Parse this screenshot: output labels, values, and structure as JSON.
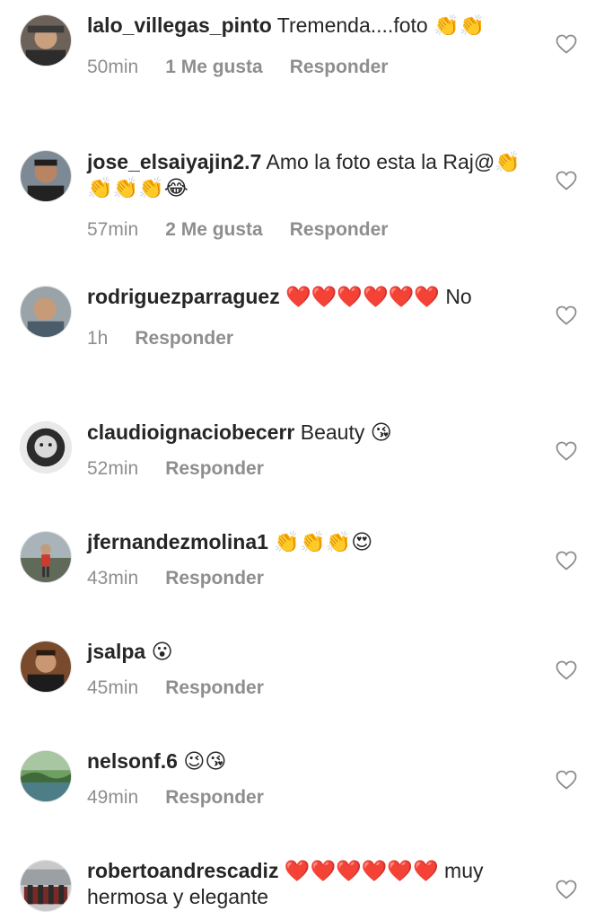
{
  "comments": [
    {
      "username": "lalo_villegas_pinto",
      "text": "Tremenda....foto 👏👏",
      "time": "50min",
      "likes": "1 Me gusta",
      "reply": "Responder"
    },
    {
      "username": "jose_elsaiyajin2.7",
      "text": "Amo la foto esta la Raj@👏👏👏👏😂",
      "time": "57min",
      "likes": "2 Me gusta",
      "reply": "Responder"
    },
    {
      "username": "rodriguezparraguez",
      "text": "❤️❤️❤️❤️❤️❤️ No",
      "time": "1h",
      "likes": "",
      "reply": "Responder"
    },
    {
      "username": "claudioignaciobecerr",
      "text": "Beauty 😘",
      "time": "52min",
      "likes": "",
      "reply": "Responder"
    },
    {
      "username": "jfernandezmolina1",
      "text": "👏👏👏😍",
      "time": "43min",
      "likes": "",
      "reply": "Responder"
    },
    {
      "username": "jsalpa",
      "text": "😮",
      "time": "45min",
      "likes": "",
      "reply": "Responder"
    },
    {
      "username": "nelsonf.6",
      "text": "😉😘",
      "time": "49min",
      "likes": "",
      "reply": "Responder"
    },
    {
      "username": "robertoandrescadiz",
      "text": "❤️❤️❤️❤️❤️❤️ muy hermosa y elegante",
      "time": "",
      "likes": "",
      "reply": ""
    }
  ],
  "icons": {
    "like": "heart-outline-icon"
  },
  "colors": {
    "text": "#262626",
    "secondary": "#8e8e8e"
  }
}
